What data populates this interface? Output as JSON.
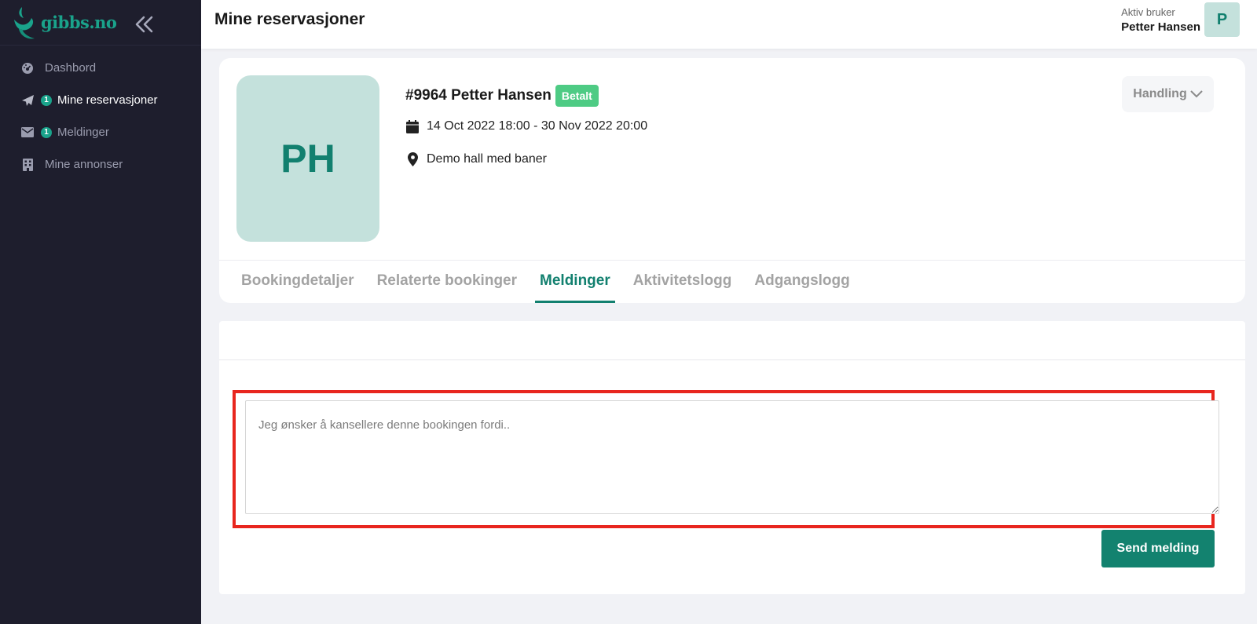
{
  "sidebar": {
    "logo_text": "gibbs.no",
    "items": [
      {
        "label": "Dashbord",
        "icon": "dashboard-icon",
        "badge": null
      },
      {
        "label": "Mine reservasjoner",
        "icon": "paper-plane-icon",
        "badge": "1"
      },
      {
        "label": "Meldinger",
        "icon": "envelope-icon",
        "badge": "1"
      },
      {
        "label": "Mine annonser",
        "icon": "building-icon",
        "badge": null
      }
    ]
  },
  "header": {
    "title": "Mine reservasjoner",
    "user_label": "Aktiv bruker",
    "user_name": "Petter Hansen",
    "user_initial": "P"
  },
  "booking": {
    "initials": "PH",
    "title": "#9964 Petter Hansen",
    "status": "Betalt",
    "dates": "14 Oct 2022 18:00 - 30 Nov 2022 20:00",
    "location": "Demo hall med baner",
    "action_label": "Handling"
  },
  "tabs": [
    {
      "label": "Bookingdetaljer"
    },
    {
      "label": "Relaterte bookinger"
    },
    {
      "label": "Meldinger"
    },
    {
      "label": "Aktivitetslogg"
    },
    {
      "label": "Adgangslogg"
    }
  ],
  "messages": {
    "placeholder": "Jeg ønsker å kansellere denne bookingen fordi..",
    "value": "",
    "send_label": "Send melding"
  },
  "colors": {
    "sidebar_bg": "#1e1e2d",
    "brand": "#12806f",
    "status_paid": "#4ecb84",
    "highlight": "#e8261e"
  }
}
